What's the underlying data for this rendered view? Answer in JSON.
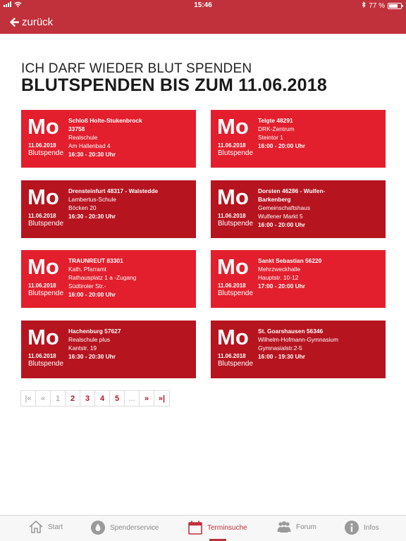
{
  "status": {
    "time": "15:46",
    "battery": "77 %",
    "battery_level": 0.77
  },
  "nav": {
    "back_label": "zurück"
  },
  "page": {
    "subtitle": "ICH DARF WIEDER BLUT SPENDEN",
    "title": "BLUTSPENDEN BIS ZUM 11.06.2018"
  },
  "cards": [
    {
      "day": "Mo",
      "date": "11.06.2018",
      "type": "Blutspende",
      "lines": [
        "Schloß Holte-Stukenbrock",
        "33758",
        "Realschule",
        "Am Hallenbad 4",
        "16:30 - 20:30 Uhr"
      ]
    },
    {
      "day": "Mo",
      "date": "11.06.2018",
      "type": "Blutspende",
      "lines": [
        "Telgte 48291",
        "DRK-Zentrum",
        "Steintor 1",
        "16:00 - 20:00 Uhr"
      ]
    },
    {
      "day": "Mo",
      "date": "11.06.2018",
      "type": "Blutspende",
      "lines": [
        "Drensteinfurt 48317 - Walstedde",
        "Lambertus-Schule",
        "Böcken 20",
        "16:30 - 20:30 Uhr"
      ]
    },
    {
      "day": "Mo",
      "date": "11.06.2018",
      "type": "Blutspende",
      "lines": [
        "Dorsten 46286 - Wulfen-",
        "Barkenberg",
        "Gemeinschaftshaus",
        "Wulfener Markt 5",
        "16:00 - 20:00 Uhr"
      ]
    },
    {
      "day": "Mo",
      "date": "11.06.2018",
      "type": "Blutspende",
      "lines": [
        "TRAUNREUT 83301",
        "Kath. Pfarramt",
        "Rathausplatz 1 a -Zugang",
        "Südtiroler Str.-",
        "16:00 - 20:00 Uhr"
      ]
    },
    {
      "day": "Mo",
      "date": "11.06.2018",
      "type": "Blutspende",
      "lines": [
        "Sankt Sebastian 56220",
        "Mehrzweckhalle",
        "Hauptstr. 10-12",
        "17:00 - 20:00 Uhr"
      ]
    },
    {
      "day": "Mo",
      "date": "11.06.2018",
      "type": "Blutspende",
      "lines": [
        "Hachenburg 57627",
        "Realschule plus",
        "Kantstr. 19",
        "16:30 - 20:30 Uhr"
      ]
    },
    {
      "day": "Mo",
      "date": "11.06.2018",
      "type": "Blutspende",
      "lines": [
        "St. Goarshausen 56346",
        "Wilhelm-Hofmann-Gymnasium",
        "Gymnasialstr.2-5",
        "16:00 - 19:30 Uhr"
      ]
    }
  ],
  "pagination": {
    "first": "|«",
    "prev": "«",
    "pages": [
      "1",
      "2",
      "3",
      "4",
      "5"
    ],
    "current": "1",
    "ellipsis": "...",
    "next": "»",
    "last": "»|"
  },
  "tabs": [
    {
      "label": "Start",
      "icon": "house-icon"
    },
    {
      "label": "Spenderservice",
      "icon": "drop-icon"
    },
    {
      "label": "Terminsuche",
      "icon": "calendar-icon",
      "active": true
    },
    {
      "label": "Forum",
      "icon": "people-icon"
    },
    {
      "label": "Infos",
      "icon": "info-icon"
    }
  ],
  "colors": {
    "brand": "#c0313b",
    "card_bright": "#e31f2d",
    "card_dark": "#b6141f"
  }
}
